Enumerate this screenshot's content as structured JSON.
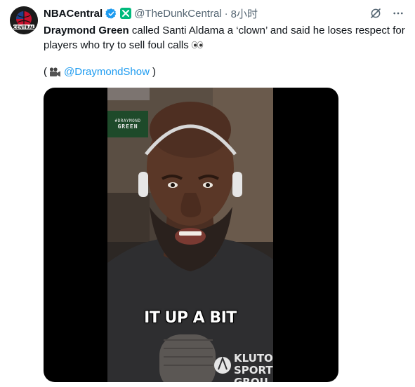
{
  "author": {
    "display_name": "NBACentral",
    "handle": "@TheDunkCentral",
    "separator": "·",
    "time": "8小时",
    "avatar_text": "CENTRAL"
  },
  "tweet": {
    "bold_name": "Draymond Green",
    "text_rest": " called Santi Aldama a ‘clown’ and said he loses respect for players who try to sell foul calls",
    "credit_open": "(",
    "credit_link": "@DraymondShow",
    "credit_close": ")"
  },
  "video": {
    "logo_top": "#DRAYMOND",
    "logo_bottom": "GREEN",
    "caption": "IT UP A BIT",
    "sponsor_line1": "KLUTO",
    "sponsor_line2": "SPORT",
    "sponsor_line3": "GROU"
  },
  "icons": {
    "verified": "verified-badge-icon",
    "affiliate": "affiliate-badge-icon",
    "grok": "grok-icon",
    "more": "more-icon",
    "camera": "video-camera-icon",
    "eyes": "eyes-emoji-icon"
  },
  "colors": {
    "link": "#1d9bf0",
    "verified": "#1d9bf0",
    "affiliate": "#00ba7c",
    "secondary_text": "#536471"
  }
}
